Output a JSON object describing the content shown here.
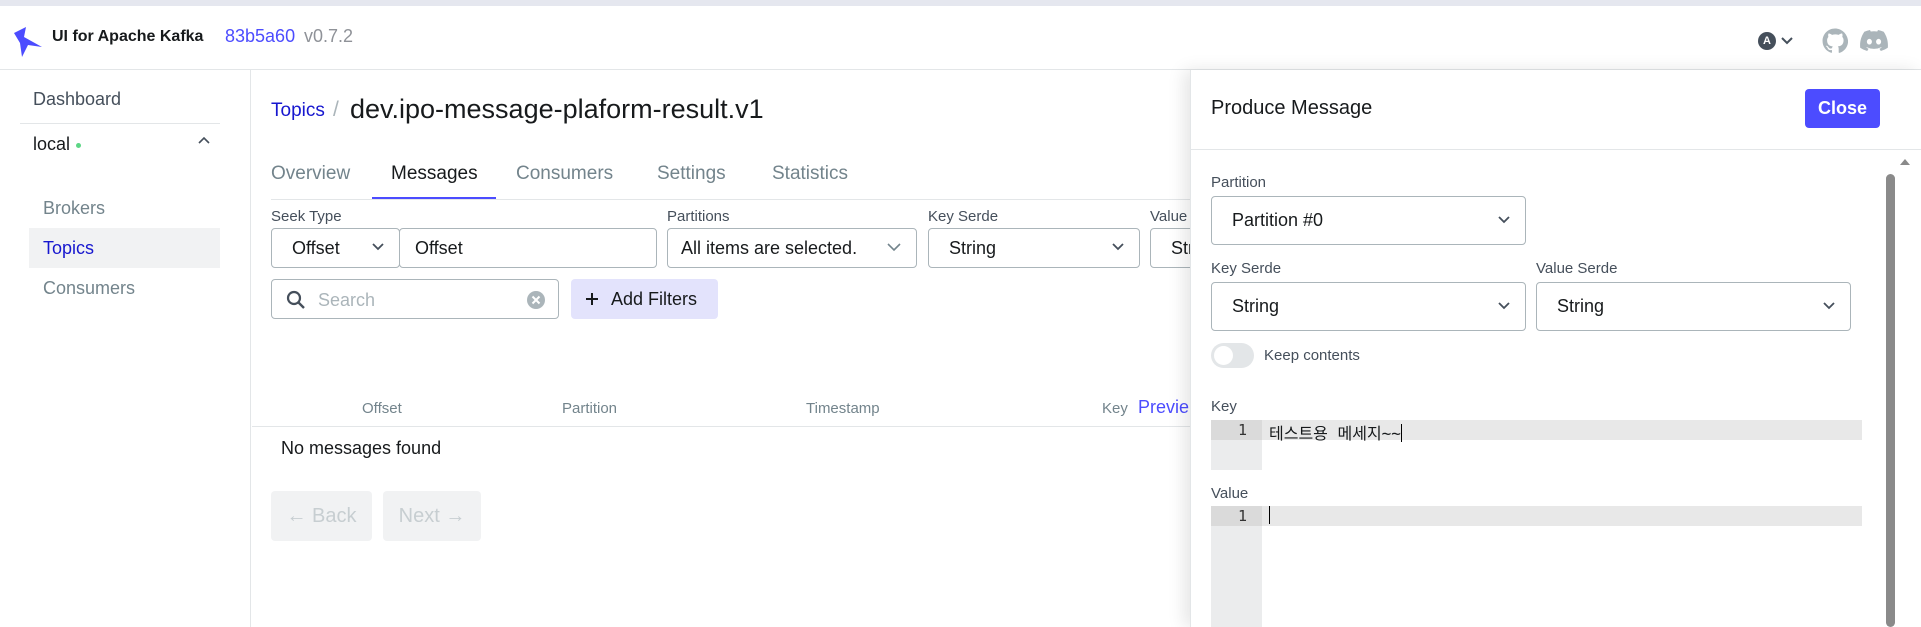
{
  "header": {
    "brand": "UI for Apache Kafka",
    "version_hash": "83b5a60",
    "version_number": "v0.7.2",
    "user_initial": "A"
  },
  "sidebar": {
    "dashboard": "Dashboard",
    "cluster": "local",
    "items": [
      {
        "label": "Brokers"
      },
      {
        "label": "Topics"
      },
      {
        "label": "Consumers"
      }
    ]
  },
  "breadcrumb": {
    "parent": "Topics",
    "separator": "/",
    "topic": "dev.ipo-message-plaform-result.v1"
  },
  "tabs": [
    {
      "label": "Overview"
    },
    {
      "label": "Messages"
    },
    {
      "label": "Consumers"
    },
    {
      "label": "Settings"
    },
    {
      "label": "Statistics"
    }
  ],
  "filters": {
    "seek_type_label": "Seek Type",
    "seek_type_value": "Offset",
    "offset_value": "Offset",
    "partitions_label": "Partitions",
    "partitions_value": "All items are selected.",
    "key_serde_label": "Key Serde",
    "key_serde_value": "String",
    "value_serde_label": "Value",
    "value_serde_value": "Str",
    "search_placeholder": "Search",
    "add_filters": "Add Filters"
  },
  "table": {
    "columns": [
      "Offset",
      "Partition",
      "Timestamp",
      "Key"
    ],
    "preview": "Previe",
    "empty": "No messages found"
  },
  "pagination": {
    "back": "← Back",
    "next": "Next →"
  },
  "produce": {
    "title": "Produce Message",
    "close": "Close",
    "partition_label": "Partition",
    "partition_value": "Partition #0",
    "key_serde_label": "Key Serde",
    "key_serde_value": "String",
    "value_serde_label": "Value Serde",
    "value_serde_value": "String",
    "keep_contents": "Keep contents",
    "keep_contents_on": false,
    "key_label": "Key",
    "key_line_no": "1",
    "key_text": "테스트용 메세지~~",
    "value_label": "Value",
    "value_line_no": "1",
    "value_text": ""
  },
  "colors": {
    "accent": "#4C4CFF",
    "link": "#1717CF",
    "status_online": "#5CD685"
  }
}
